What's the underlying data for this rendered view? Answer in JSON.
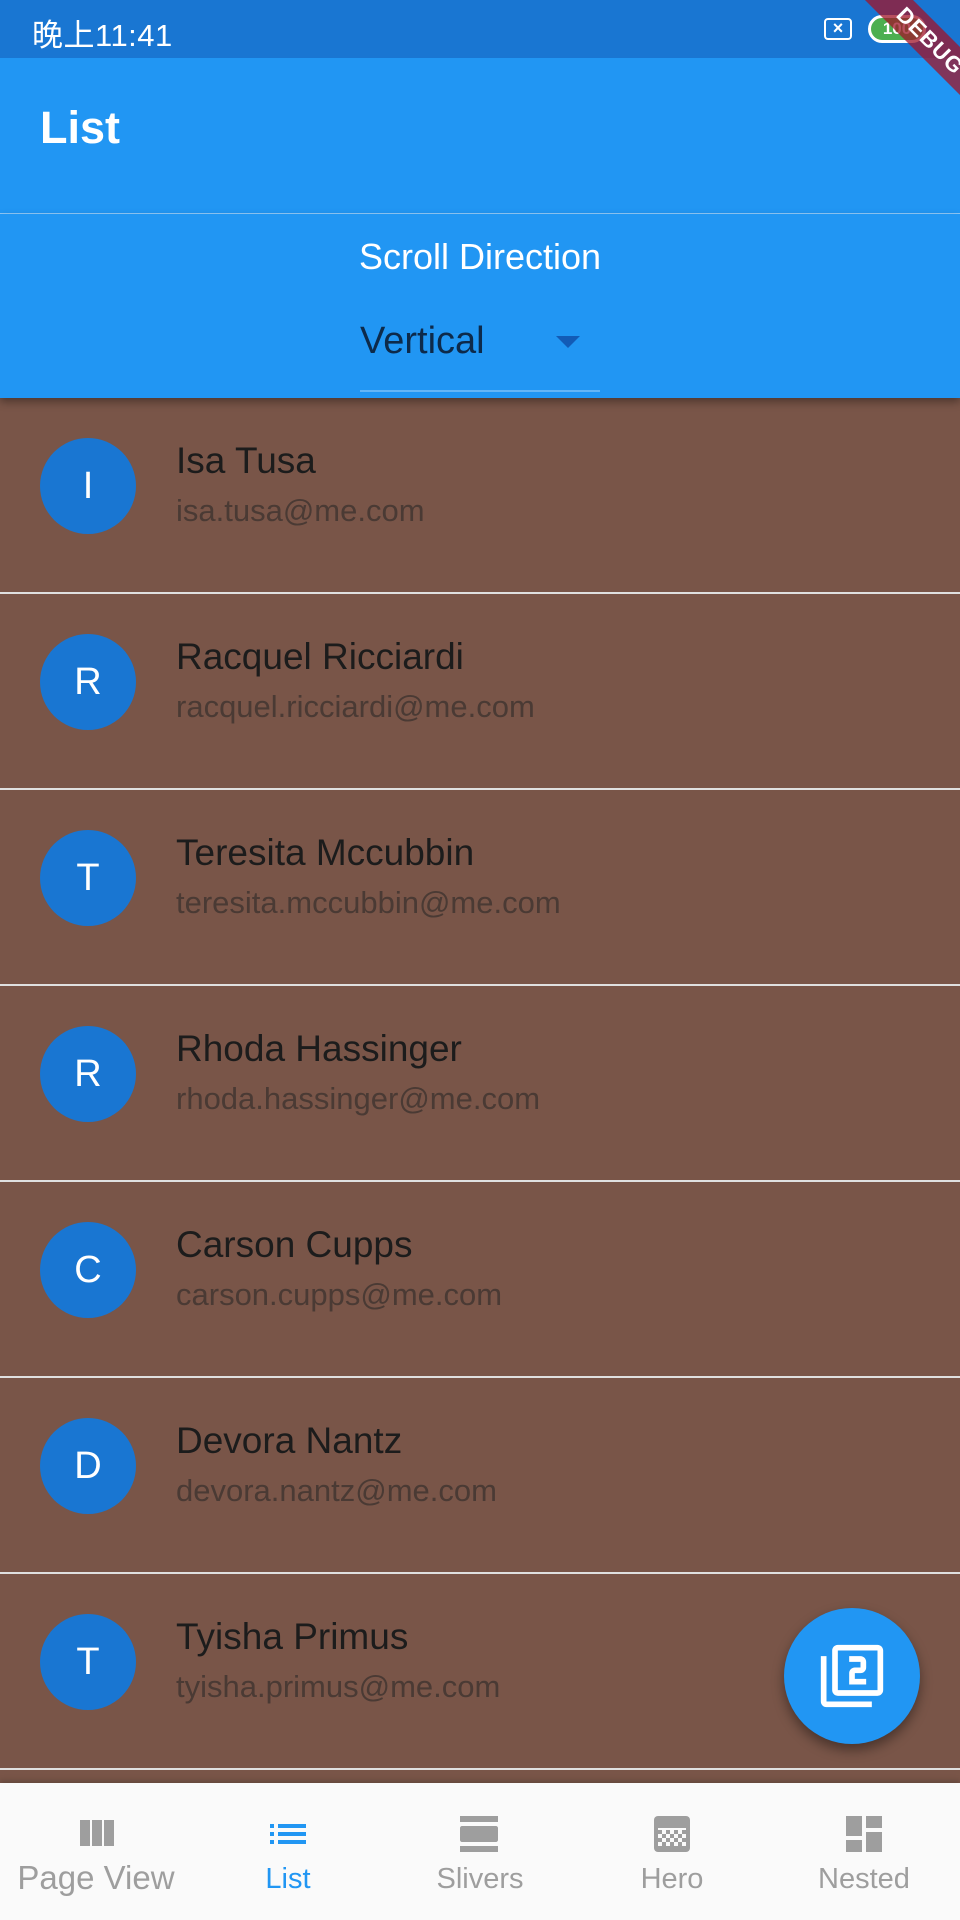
{
  "status_bar": {
    "time": "晚上11:41",
    "battery": "100",
    "debug_banner": "DEBUG"
  },
  "app_bar": {
    "title": "List"
  },
  "scroll_direction": {
    "label": "Scroll Direction",
    "selected": "Vertical"
  },
  "list": {
    "items": [
      {
        "initial": "I",
        "name": "Isa Tusa",
        "email": "isa.tusa@me.com"
      },
      {
        "initial": "R",
        "name": "Racquel Ricciardi",
        "email": "racquel.ricciardi@me.com"
      },
      {
        "initial": "T",
        "name": "Teresita Mccubbin",
        "email": "teresita.mccubbin@me.com"
      },
      {
        "initial": "R",
        "name": "Rhoda Hassinger",
        "email": "rhoda.hassinger@me.com"
      },
      {
        "initial": "C",
        "name": "Carson Cupps",
        "email": "carson.cupps@me.com"
      },
      {
        "initial": "D",
        "name": "Devora Nantz",
        "email": "devora.nantz@me.com"
      },
      {
        "initial": "T",
        "name": "Tyisha Primus",
        "email": "tyisha.primus@me.com"
      }
    ]
  },
  "fab": {
    "icon": "filter-2-icon"
  },
  "bottom_nav": {
    "items": [
      {
        "label": "Page View",
        "icon": "view-column-icon"
      },
      {
        "label": "List",
        "icon": "list-icon"
      },
      {
        "label": "Slivers",
        "icon": "view-day-icon"
      },
      {
        "label": "Hero",
        "icon": "image-icon"
      },
      {
        "label": "Nested",
        "icon": "dashboard-icon"
      }
    ],
    "active": "List"
  },
  "colors": {
    "primary": "#2196F3",
    "primary_dark": "#1976D2",
    "list_background": "#795548",
    "nav_inactive": "#9E9E9E"
  }
}
